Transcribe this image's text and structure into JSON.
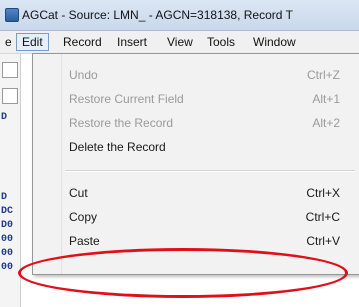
{
  "window": {
    "title": "AGCat - Source: LMN_ - AGCN=318138,  Record T"
  },
  "menubar": {
    "items": [
      {
        "label": "e"
      },
      {
        "label": "Edit"
      },
      {
        "label": "Record"
      },
      {
        "label": "Insert"
      },
      {
        "label": "View"
      },
      {
        "label": "Tools"
      },
      {
        "label": "Window"
      }
    ]
  },
  "left_strip": {
    "glyphs": [
      "D",
      "D",
      "DC",
      "D0",
      "00",
      "00",
      "00"
    ]
  },
  "edit_menu": {
    "items": [
      {
        "label": "Undo",
        "shortcut": "Ctrl+Z",
        "disabled": true
      },
      {
        "label": "Restore Current Field",
        "shortcut": "Alt+1",
        "disabled": true
      },
      {
        "label": "Restore the Record",
        "shortcut": "Alt+2",
        "disabled": true
      },
      {
        "label": "Delete the Record",
        "shortcut": "",
        "disabled": false
      },
      {
        "label": "Cut",
        "shortcut": "Ctrl+X",
        "disabled": false
      },
      {
        "label": "Copy",
        "shortcut": "Ctrl+C",
        "disabled": false
      },
      {
        "label": "Paste",
        "shortcut": "Ctrl+V",
        "disabled": false
      }
    ]
  },
  "annotation": {
    "color": "#e0101a"
  }
}
